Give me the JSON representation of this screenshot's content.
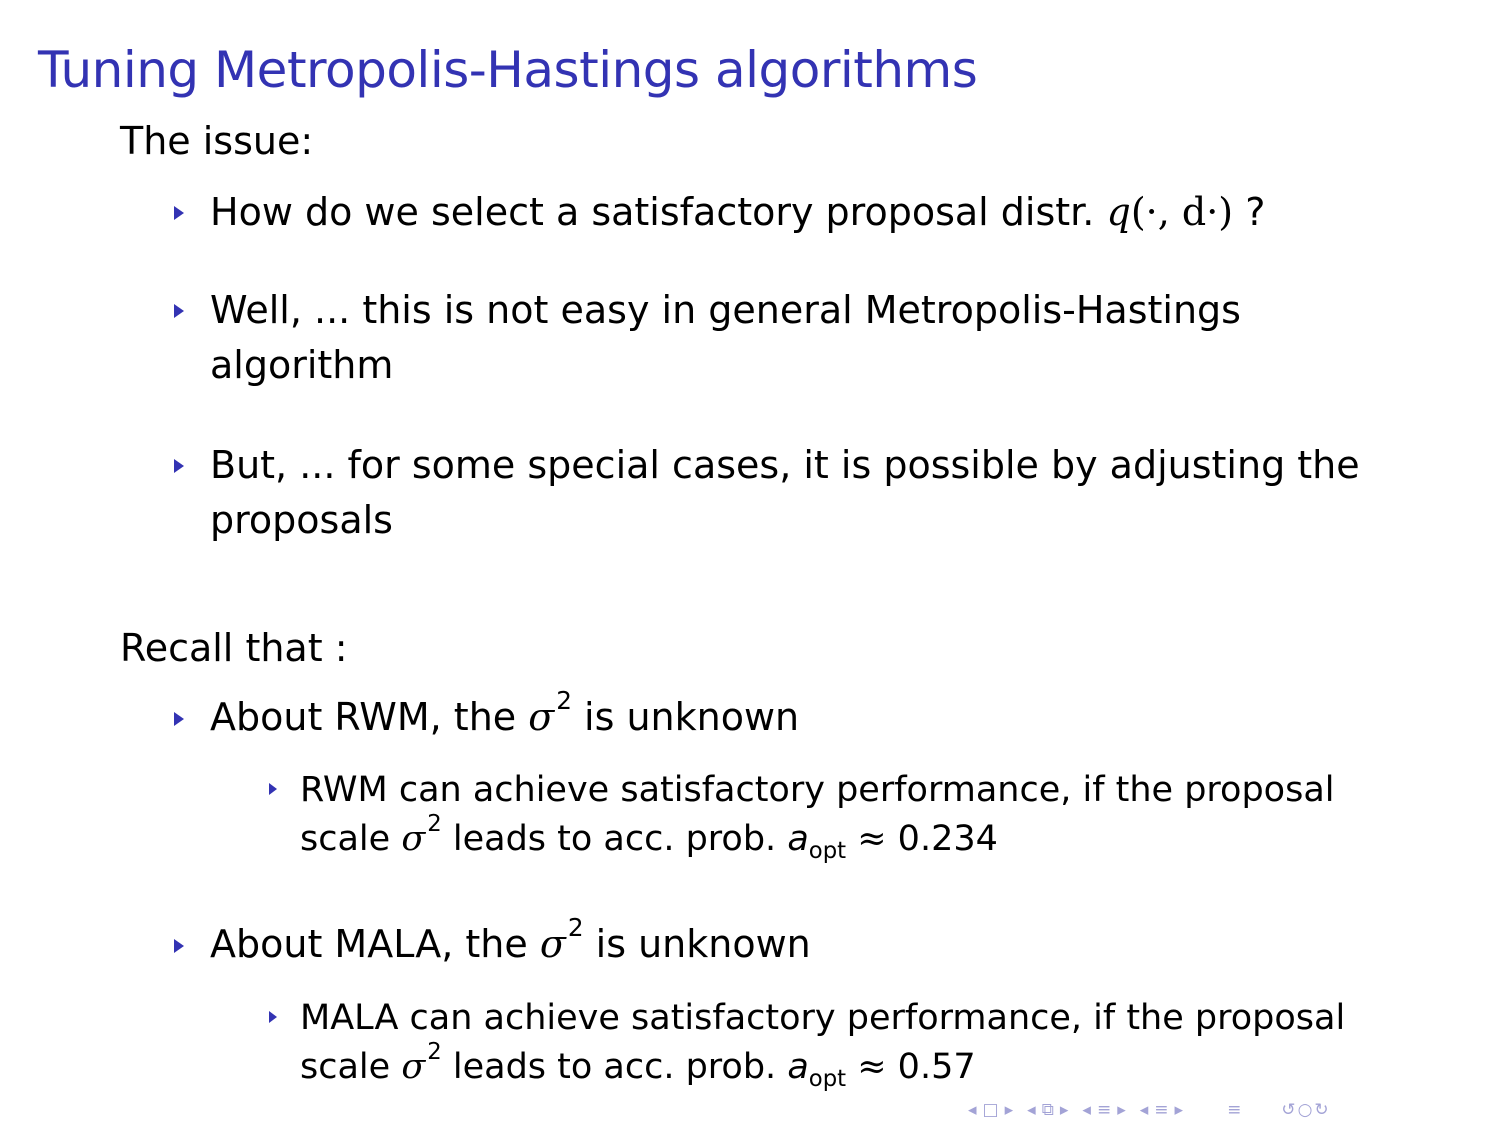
{
  "frame": {
    "title": "Tuning Metropolis-Hastings algorithms"
  },
  "issue": {
    "label": "The issue:",
    "items": [
      {
        "before": "How do we select a satisfactory proposal distr.",
        "math_q": "q",
        "math_args": "(·, d·)",
        "after": "?"
      },
      {
        "text": "Well, ... this is not easy in general Metropolis-Hastings algorithm"
      },
      {
        "text": "But, ... for some special cases, it is possible by adjusting the proposals"
      }
    ]
  },
  "recall": {
    "label": "Recall that :",
    "items": [
      {
        "before": "About RWM, the",
        "sigma": "σ",
        "exp": "2",
        "after": "is unknown",
        "sub": {
          "line1": "RWM can achieve satisfactory performance, if the proposal",
          "scale_word": "scale",
          "sigma": "σ",
          "exp": "2",
          "middle": "leads to acc. prob.",
          "a": "a",
          "a_sub": "opt",
          "approx": "≈",
          "value": "0.234"
        }
      },
      {
        "before": "About MALA, the",
        "sigma": "σ",
        "exp": "2",
        "after": "is unknown",
        "sub": {
          "line1": "MALA can achieve satisfactory performance, if the proposal",
          "scale_word": "scale",
          "sigma": "σ",
          "exp": "2",
          "middle": "leads to acc. prob.",
          "a": "a",
          "a_sub": "opt",
          "approx": "≈",
          "value": "0.57"
        }
      }
    ]
  },
  "navigation": {
    "frame_prev": "◂",
    "frame_icon": "□",
    "frame_next": "▸",
    "subsection_prev": "◂",
    "subsection_icon": "⧉",
    "subsection_next": "▸",
    "section_prev": "◂",
    "section_icon": "≡",
    "section_next": "▸",
    "section2_prev": "◂",
    "section2_icon": "≡",
    "section2_next": "▸",
    "doc_icon": "≡",
    "search_icon": "↺",
    "search2_icon": "○",
    "search3_icon": "↻",
    "colors": {
      "nav": "#a3a3d6",
      "title": "#3333b3"
    }
  }
}
